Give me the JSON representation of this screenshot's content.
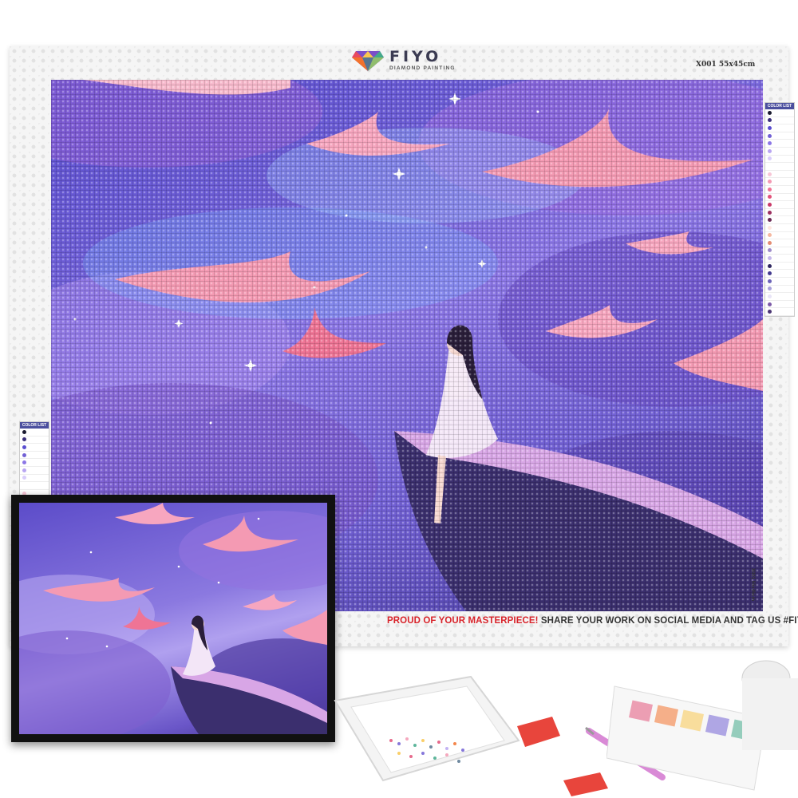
{
  "brand": {
    "name": "FIYO",
    "tagline": "DIAMOND PAINTING"
  },
  "product": {
    "size_code": "X001 55x45cm",
    "vertical_code": "X001 55x45cm"
  },
  "footer": {
    "highlight": "PROUD OF YOUR MASTERPIECE!",
    "message": " SHARE YOUR WORK ON SOCIAL MEDIA AND TAG US ",
    "tag": "#FIYO"
  },
  "color_list": {
    "title": "COLOR LIST",
    "colors": [
      "#1a1a2e",
      "#3b2f7a",
      "#5a4ed0",
      "#7160d4",
      "#8c77e6",
      "#b9a6f2",
      "#d9cdfb",
      "#ffffff",
      "#f7c6d6",
      "#f49ab3",
      "#ef7495",
      "#e3527a",
      "#c93a68",
      "#9c2f5f",
      "#6a2a55",
      "#fde7e1",
      "#f5b8a0",
      "#e48d73",
      "#9d8cc9",
      "#c5b8ea",
      "#2f2760",
      "#433a8f",
      "#6b63b8",
      "#a9a2db",
      "#e8e4f7",
      "#7c5aa8",
      "#4a3573"
    ]
  },
  "colors": {
    "sky_deep": "#473a9c",
    "sky_mid": "#7160d4",
    "sky_light": "#8c77e6",
    "ray_pink": "#f49ab3",
    "accent_red": "#d8232a",
    "frame": "#111111"
  }
}
